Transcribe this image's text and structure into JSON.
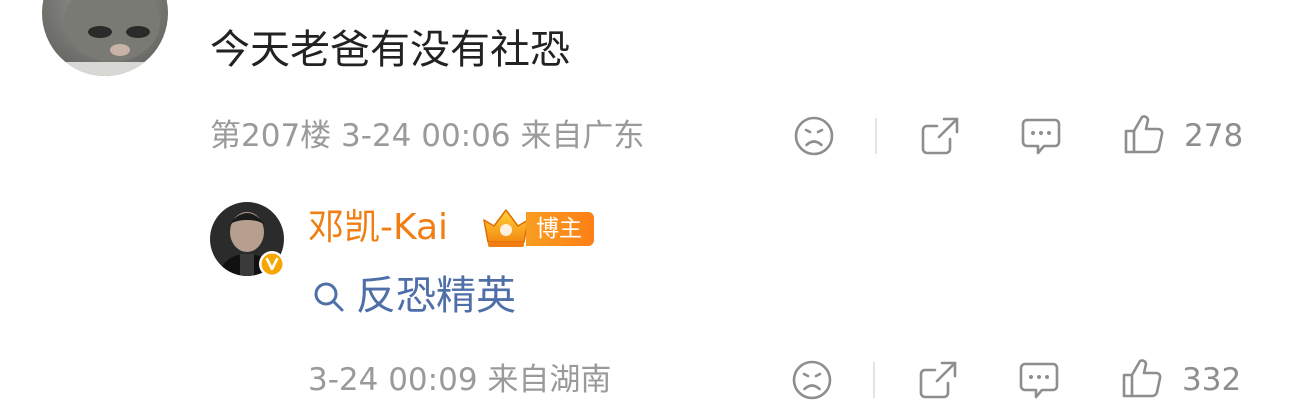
{
  "comment": {
    "text": "今天老爸有没有社恐",
    "floor": "第207楼",
    "time": "3-24 00:06",
    "location": "来自广东",
    "like_count": "278"
  },
  "reply": {
    "author": "邓凯-Kai",
    "author_badge": "博主",
    "text": "反恐精英",
    "time": "3-24 00:09",
    "location": "来自湖南",
    "like_count": "332"
  },
  "colors": {
    "author_name": "#f07e12",
    "link_text": "#4f6fa8",
    "meta_text": "#9a9a9a",
    "icon_gray": "#8e8e8e",
    "badge_orange": "#fd7f16"
  },
  "icons": [
    "sad-face-icon",
    "share-icon",
    "comment-icon",
    "thumb-up-icon",
    "search-icon",
    "verified-v-icon",
    "crown-icon"
  ]
}
